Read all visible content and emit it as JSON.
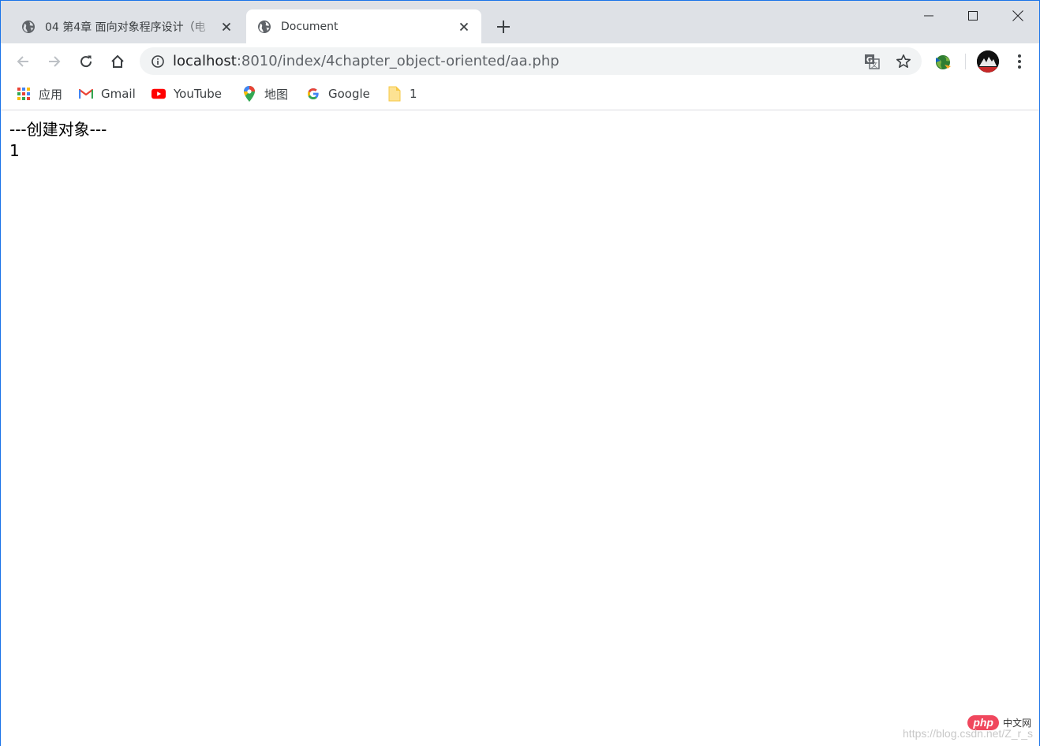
{
  "tabs": [
    {
      "title": "04 第4章 面向对象程序设计（电",
      "active": false
    },
    {
      "title": "Document",
      "active": true
    }
  ],
  "omnibox": {
    "url_host": "localhost",
    "url_rest": ":8010/index/4chapter_object-oriented/aa.php"
  },
  "bookmarks": [
    {
      "label": "应用",
      "icon": "apps-grid-icon"
    },
    {
      "label": "Gmail",
      "icon": "gmail-icon"
    },
    {
      "label": "YouTube",
      "icon": "youtube-icon"
    },
    {
      "label": "地图",
      "icon": "maps-pin-icon"
    },
    {
      "label": "Google",
      "icon": "google-g-icon"
    },
    {
      "label": "1",
      "icon": "folder-icon"
    }
  ],
  "page": {
    "line1": "---创建对象---",
    "line2": "1"
  },
  "watermark": {
    "logo": "php",
    "site": "中文网",
    "url": "https://blog.csdn.net/Z_r_s"
  },
  "colors": {
    "tabstrip": "#dee1e6",
    "omnibox": "#f1f3f4",
    "accent": "#1a73e8"
  }
}
